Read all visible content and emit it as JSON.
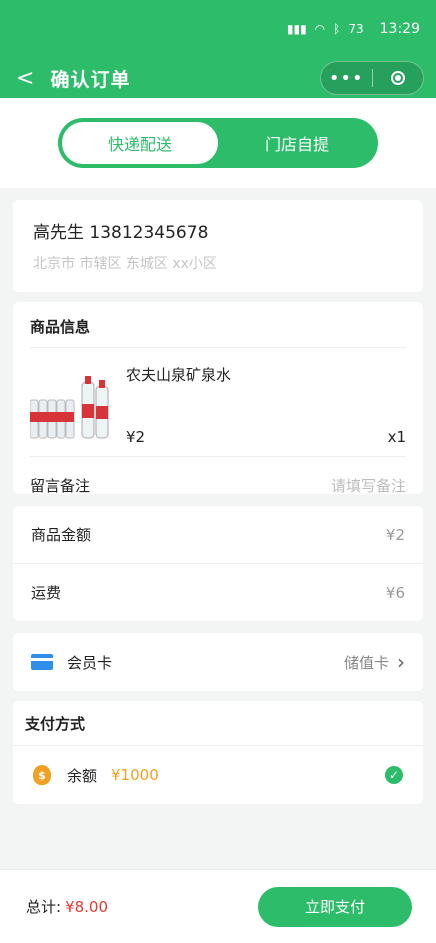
{
  "status_bar": {
    "time": "13:29",
    "battery": "73"
  },
  "nav": {
    "back_glyph": "<",
    "title": "确认订单",
    "menu_glyph": "•••"
  },
  "delivery_tabs": [
    {
      "label": "快递配送",
      "active": true
    },
    {
      "label": "门店自提",
      "active": false
    }
  ],
  "address": {
    "name_phone": "高先生 13812345678",
    "detail": "北京市 市辖区 东城区 xx小区"
  },
  "goods": {
    "section_title": "商品信息",
    "item": {
      "name": "农夫山泉矿泉水",
      "price": "¥2",
      "qty": "x1"
    },
    "remark_label": "留言备注",
    "remark_placeholder": "请填写备注"
  },
  "amounts": [
    {
      "label": "商品金额",
      "value": "¥2"
    },
    {
      "label": "运费",
      "value": "¥6"
    }
  ],
  "member": {
    "label": "会员卡",
    "value": "储值卡"
  },
  "payment": {
    "title": "支付方式",
    "method_label": "余额",
    "method_value": "¥1000"
  },
  "footer": {
    "total_label": "总计:",
    "total_value": "¥8.00",
    "pay_button": "立即支付"
  },
  "colors": {
    "primary": "#2dbc6a",
    "price_red": "#e53935",
    "balance_orange": "#f0a023",
    "card_blue": "#2f8fe8"
  }
}
